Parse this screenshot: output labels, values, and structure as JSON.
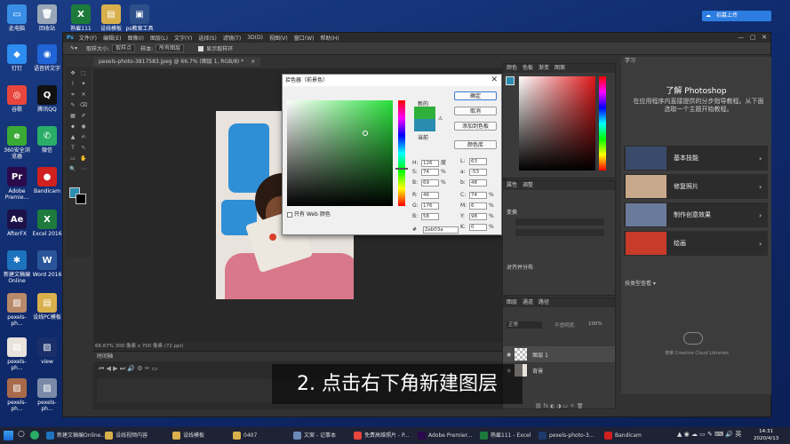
{
  "desktop": {
    "icons": [
      {
        "label": "此电脑",
        "color": "#3a8ee6",
        "glyph": "▭"
      },
      {
        "label": "回收站",
        "color": "#9aa7b8",
        "glyph": "🗑"
      },
      {
        "label": "熟雇111",
        "color": "#1d7a3c",
        "glyph": "X"
      },
      {
        "label": "设线模板",
        "color": "#d8b04c",
        "glyph": "▤"
      },
      {
        "label": "ps教案工具",
        "color": "#2d4f8a",
        "glyph": "▣"
      },
      {
        "label": "钉钉",
        "color": "#2d8cf0",
        "glyph": "◆"
      },
      {
        "label": "语音转文字",
        "color": "#2064d8",
        "glyph": "◉"
      },
      {
        "label": "谷歌",
        "color": "#e8453c",
        "glyph": "◎"
      },
      {
        "label": "腾讯QQ",
        "color": "#111111",
        "glyph": "Q"
      },
      {
        "label": "360安全浏览器",
        "color": "#3aaa35",
        "glyph": "e"
      },
      {
        "label": "微信",
        "color": "#2aae67",
        "glyph": "✆"
      },
      {
        "label": "Adobe Premie...",
        "color": "#2a0a4a",
        "glyph": "Pr"
      },
      {
        "label": "Bandicam",
        "color": "#d02020",
        "glyph": "●"
      },
      {
        "label": "AfterFX",
        "color": "#1d1247",
        "glyph": "Ae"
      },
      {
        "label": "Excel 2016",
        "color": "#1d7a3c",
        "glyph": "X"
      },
      {
        "label": "新建文稿编Online",
        "color": "#1e73be",
        "glyph": "✱"
      },
      {
        "label": "Word 2016",
        "color": "#2a5699",
        "glyph": "W"
      },
      {
        "label": "pexels-ph...",
        "color": "#b88a6a",
        "glyph": "▨"
      },
      {
        "label": "设线PC模板",
        "color": "#d8b04c",
        "glyph": "▤"
      },
      {
        "label": "pexels-ph...",
        "color": "#e9e3dd",
        "glyph": "▨"
      },
      {
        "label": "view",
        "color": "#1a2f6a",
        "glyph": "▨"
      },
      {
        "label": "pexels-ph...",
        "color": "#a86a4a",
        "glyph": "▨"
      },
      {
        "label": "pexels-ph...",
        "color": "#7a8aa8",
        "glyph": "▨"
      }
    ],
    "cloud_button": "招募上传"
  },
  "photoshop": {
    "menu": [
      "文件(F)",
      "编辑(E)",
      "图像(I)",
      "图层(L)",
      "文字(Y)",
      "选择(S)",
      "滤镜(T)",
      "3D(D)",
      "视图(V)",
      "窗口(W)",
      "帮助(H)"
    ],
    "options": {
      "sample_size_label": "取样大小:",
      "sample_size_value": "取样点",
      "sample_label": "样本:",
      "sample_value": "所有图层",
      "show_ring": "显示取样环"
    },
    "doc_tab": "pexels-photo-3817583.jpeg @ 66.7% (图层 1, RGB/8) *",
    "status": "66.67%      300 像素 x 700 像素 (72 ppi)",
    "timeline_title": "时间轴",
    "picker": {
      "title": "拾色器（前景色）",
      "ok": "确定",
      "cancel": "取消",
      "add_swatch": "添加到色板",
      "color_lib": "颜色库",
      "new_label": "新的",
      "current_label": "当前",
      "only_web": "只有 Web 颜色",
      "hsb": [
        {
          "l": "H:",
          "v": "126",
          "u": "度"
        },
        {
          "l": "S:",
          "v": "74",
          "u": "%"
        },
        {
          "l": "B:",
          "v": "69",
          "u": "%"
        }
      ],
      "rgb": [
        {
          "l": "R:",
          "v": "46"
        },
        {
          "l": "G:",
          "v": "176"
        },
        {
          "l": "B:",
          "v": "58"
        }
      ],
      "lab": [
        {
          "l": "L:",
          "v": "63"
        },
        {
          "l": "a:",
          "v": "-53"
        },
        {
          "l": "b:",
          "v": "48"
        }
      ],
      "cmyk": [
        {
          "l": "C:",
          "v": "74",
          "u": "%"
        },
        {
          "l": "M:",
          "v": "6",
          "u": "%"
        },
        {
          "l": "Y:",
          "v": "98",
          "u": "%"
        },
        {
          "l": "K:",
          "v": "0",
          "u": "%"
        }
      ],
      "hex_label": "#",
      "hex": "2eb03a",
      "new_color": "#2eb03a",
      "current_color": "#2a8db0"
    },
    "panels": {
      "color_tabs": [
        "颜色",
        "色板",
        "渐变",
        "图案"
      ],
      "props_tabs": [
        "属性",
        "调整"
      ],
      "transform": "变换",
      "align": "对齐并分布",
      "layers_tabs": [
        "图层",
        "通道",
        "路径"
      ],
      "layers": [
        {
          "name": "图层 1"
        },
        {
          "name": "背景"
        }
      ],
      "blend": "正常",
      "opacity_label": "不透明度:",
      "opacity": "100%"
    },
    "learn": {
      "tab": "学习",
      "title": "了解 Photoshop",
      "desc": "在应用程序内直接提供的分步指导教程。从下面选取一个主题开始教程。",
      "items": [
        {
          "label": "基本技能",
          "color": "#3a4a6a"
        },
        {
          "label": "修复照片",
          "color": "#c8a88a"
        },
        {
          "label": "制作创意效果",
          "color": "#6a7a9a"
        },
        {
          "label": "绘画",
          "color": "#c83a2a"
        }
      ],
      "search": "搜索 Creative Cloud Libraries",
      "libs_label": "技类型查看"
    }
  },
  "caption": "2. 点击右下角新建图层",
  "taskbar": {
    "items": [
      {
        "label": "新建文稿编Online...",
        "color": "#1e73be"
      },
      {
        "label": "设线视频内容",
        "color": "#d8b04c"
      },
      {
        "label": "设线模板",
        "color": "#d8b04c"
      },
      {
        "label": "0407",
        "color": "#d8b04c"
      },
      {
        "label": "文案 - 记事本",
        "color": "#6a8ab8"
      },
      {
        "label": "免费高维照片 - P...",
        "color": "#e8453c"
      },
      {
        "label": "Adobe Premier...",
        "color": "#2a0a4a"
      },
      {
        "label": "熟雇111 - Excel",
        "color": "#1d7a3c"
      },
      {
        "label": "pexels-photo-3...",
        "color": "#1c3b6a"
      },
      {
        "label": "Bandicam",
        "color": "#d02020"
      }
    ],
    "time": "14:31",
    "date": "2020/4/13"
  }
}
